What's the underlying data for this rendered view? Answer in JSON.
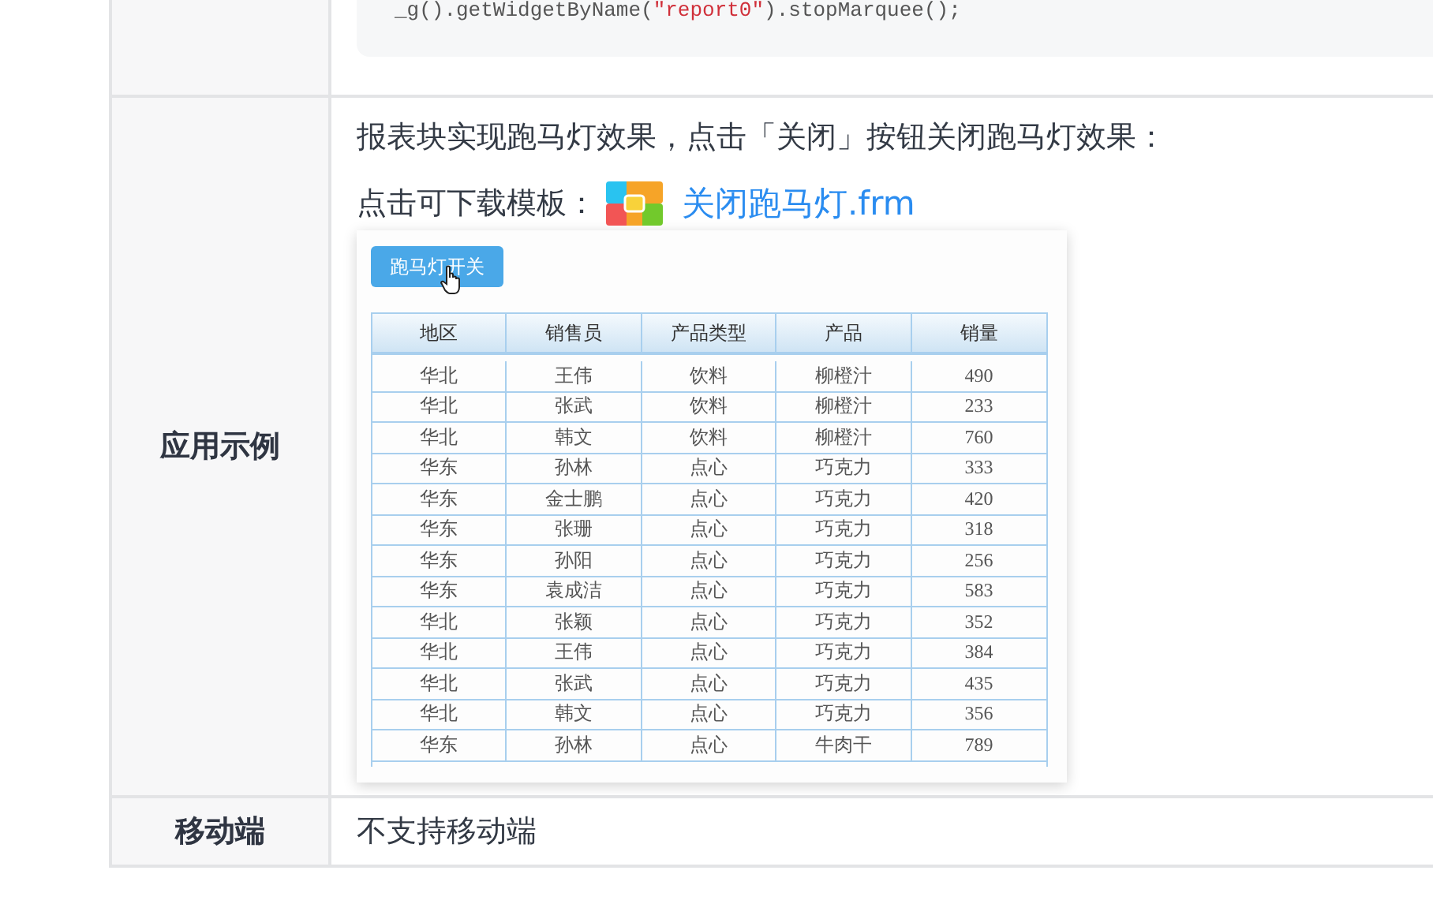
{
  "rows": [
    {
      "kind": "code",
      "code": [
        {
          "kind": "plain",
          "text": "_g().getWidgetByName("
        },
        {
          "kind": "string",
          "text": "\"report0\""
        },
        {
          "kind": "plain",
          "text": ").stopMarquee();"
        }
      ]
    },
    {
      "kind": "example",
      "label": "应用示例",
      "text": "报表块实现跑马灯效果，点击「关闭」按钮关闭跑马灯效果：",
      "download_label": "点击可下载模板：",
      "file_link": "关闭跑马灯.frm",
      "preview": {
        "button": "跑马灯开关",
        "columns": [
          "地区",
          "销售员",
          "产品类型",
          "产品",
          "销量"
        ],
        "rows": [
          [
            "华北",
            "王伟",
            "饮料",
            "柳橙汁",
            "490"
          ],
          [
            "华北",
            "张武",
            "饮料",
            "柳橙汁",
            "233"
          ],
          [
            "华北",
            "韩文",
            "饮料",
            "柳橙汁",
            "760"
          ],
          [
            "华东",
            "孙林",
            "点心",
            "巧克力",
            "333"
          ],
          [
            "华东",
            "金士鹏",
            "点心",
            "巧克力",
            "420"
          ],
          [
            "华东",
            "张珊",
            "点心",
            "巧克力",
            "318"
          ],
          [
            "华东",
            "孙阳",
            "点心",
            "巧克力",
            "256"
          ],
          [
            "华东",
            "袁成洁",
            "点心",
            "巧克力",
            "583"
          ],
          [
            "华北",
            "张颖",
            "点心",
            "巧克力",
            "352"
          ],
          [
            "华北",
            "王伟",
            "点心",
            "巧克力",
            "384"
          ],
          [
            "华北",
            "张武",
            "点心",
            "巧克力",
            "435"
          ],
          [
            "华北",
            "韩文",
            "点心",
            "巧克力",
            "356"
          ],
          [
            "华东",
            "孙林",
            "点心",
            "牛肉干",
            "789"
          ]
        ]
      }
    },
    {
      "kind": "text",
      "label": "移动端",
      "text": "不支持移动端"
    }
  ]
}
